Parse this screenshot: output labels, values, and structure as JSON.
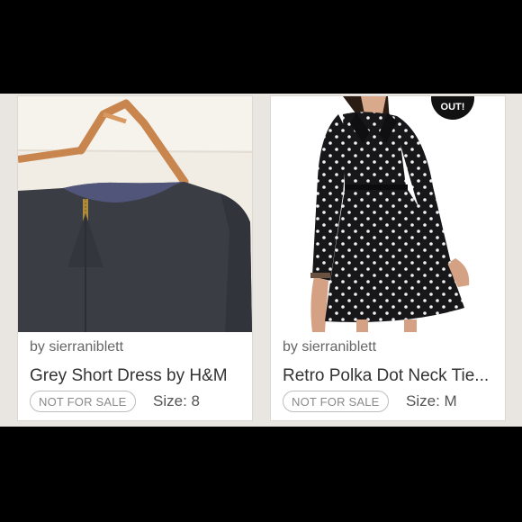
{
  "listings": [
    {
      "seller": "by sierraniblett",
      "title": "Grey Short Dress by H&M",
      "status": "NOT FOR SALE",
      "size": "Size: 8"
    },
    {
      "seller": "by sierraniblett",
      "title": "Retro Polka Dot Neck Tie...",
      "status": "NOT FOR SALE",
      "size": "Size: M",
      "corner_badge": "OUT!"
    }
  ]
}
